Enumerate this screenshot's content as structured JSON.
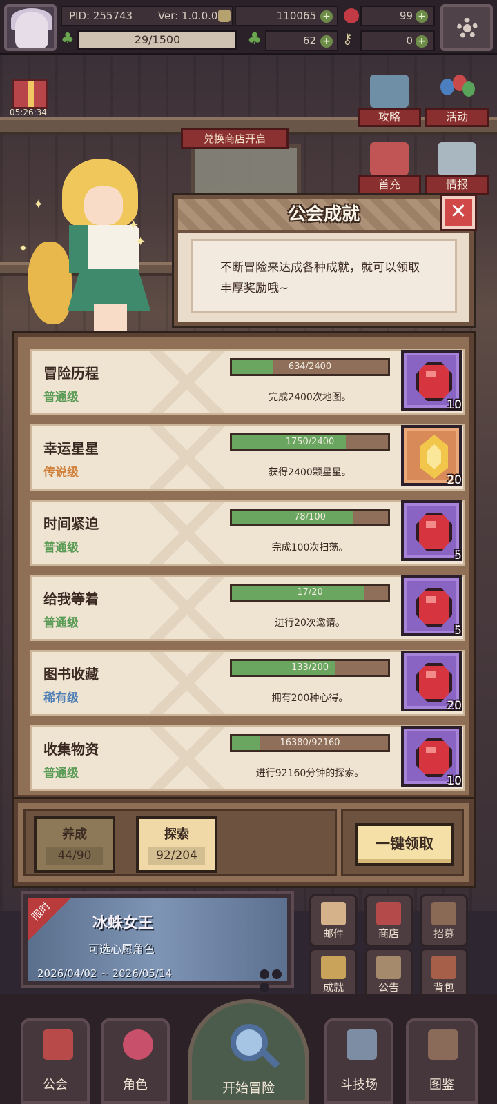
{
  "topbar": {
    "pid": "PID: 255743",
    "version": "Ver: 1.0.0.0",
    "gold": "110065",
    "gems": "99",
    "xp": "29/1500",
    "clover": "62",
    "keys": "0"
  },
  "timer": "05:26:34",
  "side_buttons": {
    "strategy": "攻略",
    "event": "活动",
    "first_charge": "首充",
    "intel": "情报"
  },
  "shop_banner": "兑换商店开启",
  "dialog": {
    "title": "公会成就",
    "close": "✕",
    "description": "不断冒险来达成各种成就，就可以领取丰厚奖励哦~"
  },
  "achievements": [
    {
      "name": "冒险历程",
      "tier": "普通级",
      "tier_color": "#5a9c55",
      "progress_text": "634/2400",
      "progress": 0.264,
      "desc": "完成2400次地图。",
      "reward_type": "red-gem",
      "reward_bg": "purple",
      "reward_count": "10"
    },
    {
      "name": "幸运星星",
      "tier": "传说级",
      "tier_color": "#d0803a",
      "progress_text": "1750/2400",
      "progress": 0.729,
      "desc": "获得2400颗星星。",
      "reward_type": "gold-gem",
      "reward_bg": "orange",
      "reward_count": "20"
    },
    {
      "name": "时间紧迫",
      "tier": "普通级",
      "tier_color": "#5a9c55",
      "progress_text": "78/100",
      "progress": 0.78,
      "desc": "完成100次扫荡。",
      "reward_type": "red-gem",
      "reward_bg": "purple",
      "reward_count": "5"
    },
    {
      "name": "给我等着",
      "tier": "普通级",
      "tier_color": "#5a9c55",
      "progress_text": "17/20",
      "progress": 0.85,
      "desc": "进行20次邀请。",
      "reward_type": "red-gem",
      "reward_bg": "purple",
      "reward_count": "5"
    },
    {
      "name": "图书收藏",
      "tier": "稀有级",
      "tier_color": "#4f7fb5",
      "progress_text": "133/200",
      "progress": 0.665,
      "desc": "拥有200种心得。",
      "reward_type": "red-gem",
      "reward_bg": "purple",
      "reward_count": "20"
    },
    {
      "name": "收集物资",
      "tier": "普通级",
      "tier_color": "#5a9c55",
      "progress_text": "16380/92160",
      "progress": 0.178,
      "desc": "进行92160分钟的探索。",
      "reward_type": "red-gem",
      "reward_bg": "purple",
      "reward_count": "10"
    }
  ],
  "tabs": [
    {
      "label": "养成",
      "count": "44/90",
      "active": false
    },
    {
      "label": "探索",
      "count": "92/204",
      "active": true
    }
  ],
  "claim_all": "一键领取",
  "event": {
    "ribbon": "限时",
    "title": "冰蛛女王",
    "subtitle": "可选心愿角色",
    "dates": "2026/04/02 ~ 2026/05/14"
  },
  "mini_menu": [
    "邮件",
    "商店",
    "招募",
    "成就",
    "公告",
    "背包"
  ],
  "bottom_nav": {
    "guild": "公会",
    "character": "角色",
    "start": "开始冒险",
    "arena": "斗技场",
    "codex": "图鉴"
  },
  "colors": {
    "tier_common": "#5a9c55",
    "tier_legend": "#d0803a",
    "tier_rare": "#4f7fb5",
    "progress_fill": "#6aa660",
    "reward_purple": "#8a64c2",
    "reward_orange": "#d88a58"
  }
}
